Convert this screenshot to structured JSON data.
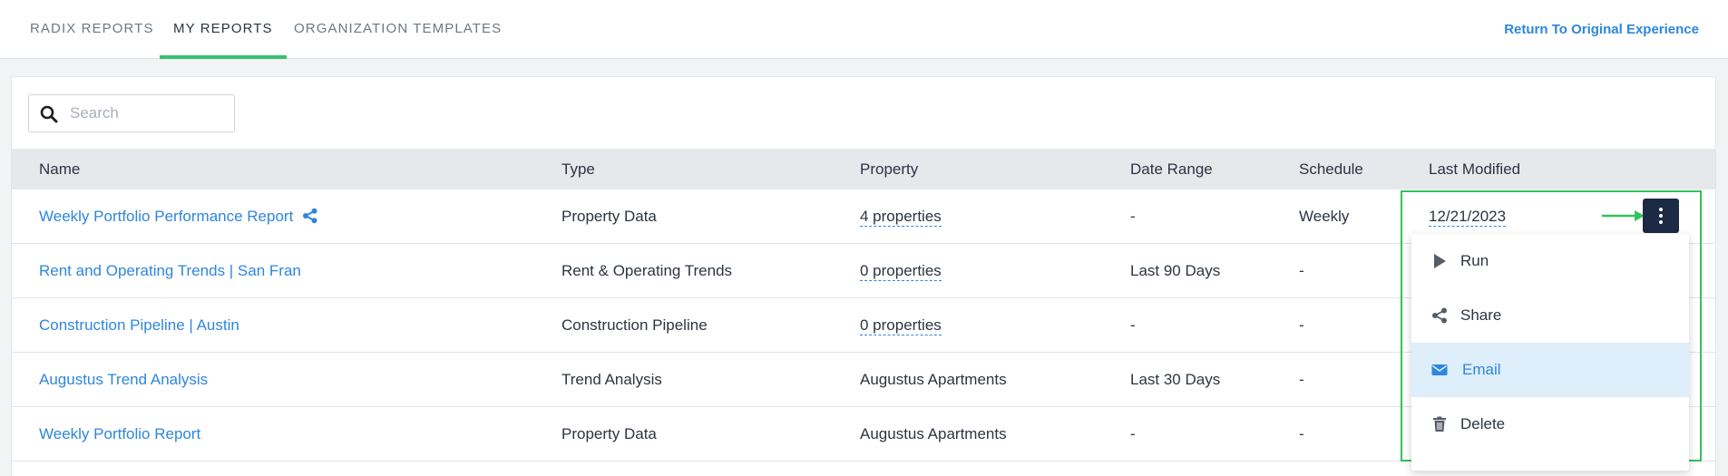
{
  "tabs": [
    {
      "label": "RADIX REPORTS"
    },
    {
      "label": "MY REPORTS"
    },
    {
      "label": "ORGANIZATION TEMPLATES"
    }
  ],
  "active_tab": "MY REPORTS",
  "return_link": "Return To Original Experience",
  "search": {
    "placeholder": "Search",
    "value": ""
  },
  "table": {
    "columns": [
      "Name",
      "Type",
      "Property",
      "Date Range",
      "Schedule",
      "Last Modified"
    ],
    "rows": [
      {
        "name": "Weekly Portfolio Performance Report",
        "shared": true,
        "type": "Property Data",
        "property": "4 properties",
        "date_range": "-",
        "schedule": "Weekly",
        "last_modified": "12/21/2023"
      },
      {
        "name": "Rent and Operating Trends | San Fran",
        "shared": false,
        "type": "Rent & Operating Trends",
        "property": "0 properties",
        "date_range": "Last 90 Days",
        "schedule": "-",
        "last_modified": ""
      },
      {
        "name": "Construction Pipeline | Austin",
        "shared": false,
        "type": "Construction Pipeline",
        "property": "0 properties",
        "date_range": "-",
        "schedule": "-",
        "last_modified": ""
      },
      {
        "name": "Augustus Trend Analysis",
        "shared": false,
        "type": "Trend Analysis",
        "property": "Augustus Apartments",
        "date_range": "Last 30 Days",
        "schedule": "-",
        "last_modified": ""
      },
      {
        "name": "Weekly Portfolio Report",
        "shared": false,
        "type": "Property Data",
        "property": "Augustus Apartments",
        "date_range": "-",
        "schedule": "-",
        "last_modified": ""
      }
    ]
  },
  "action_menu": {
    "items": [
      {
        "label": "Run",
        "icon": "play-icon"
      },
      {
        "label": "Share",
        "icon": "share-icon"
      },
      {
        "label": "Email",
        "icon": "envelope-icon",
        "selected": true
      },
      {
        "label": "Delete",
        "icon": "trash-icon"
      }
    ]
  },
  "colors": {
    "accent": "#34c26f",
    "link": "#2e86de",
    "action_button": "#1c2a45",
    "highlight": "#33c25e",
    "selected_bg": "#deeefb"
  }
}
